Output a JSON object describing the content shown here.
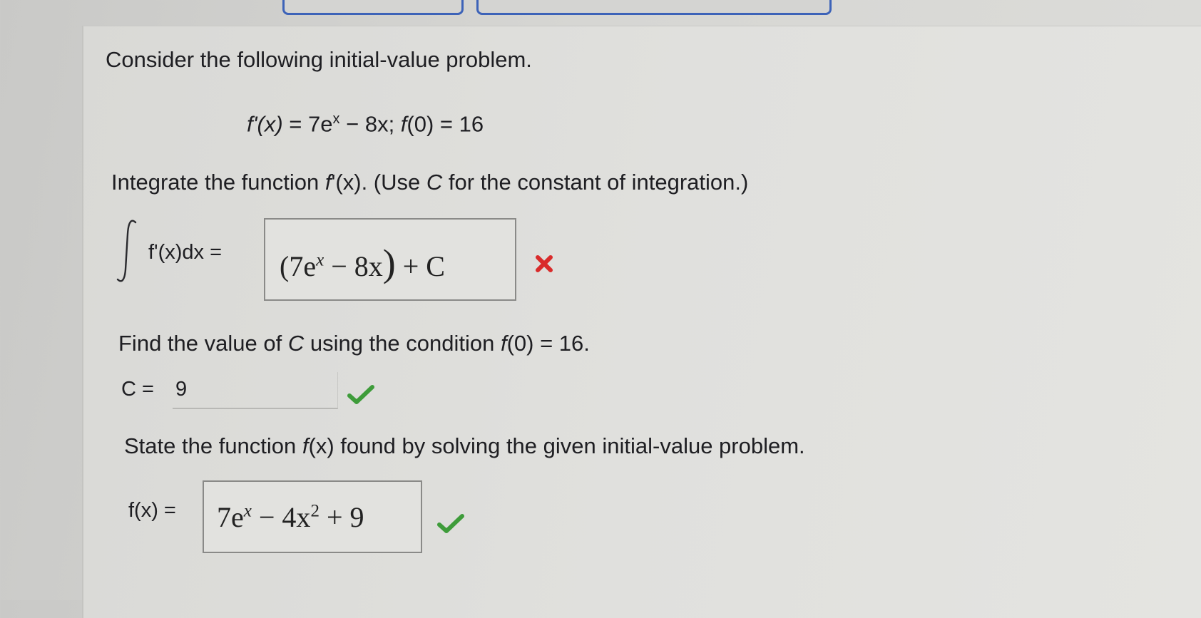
{
  "tabs": [],
  "intro": "Consider the following initial-value problem.",
  "equation": {
    "lhs": "f'(x)",
    "eq1": " = 7e",
    "exp": "x",
    "mid": " − 8x; ",
    "f0": "f",
    "rhs": "(0) = 16"
  },
  "step1": {
    "instruction_a": "Integrate the function ",
    "instruction_f": "f",
    "instruction_b": "'(x). (Use ",
    "instruction_c": "C",
    "instruction_d": " for the constant of integration.)",
    "integral_label": "f'(x)dx =",
    "answer_part1": "(7e",
    "answer_exp": "x",
    "answer_part2": " − 8x",
    "answer_paren": ")",
    "answer_part3": " + C",
    "status": "incorrect",
    "status_color": "#d92b2b"
  },
  "step2": {
    "instruction_a": "Find the value of ",
    "instruction_c": "C",
    "instruction_b": " using the condition ",
    "instruction_f": "f",
    "instruction_d": "(0) = 16.",
    "label": "C =",
    "value": "9",
    "status": "correct",
    "status_color": "#3e9c3a"
  },
  "step3": {
    "instruction_a": "State the function ",
    "instruction_f": "f",
    "instruction_b": "(x) found by solving the given initial-value problem.",
    "label": "f(x) =",
    "answer_part1": "7e",
    "answer_exp": "x",
    "answer_part2": " − 4x",
    "answer_exp2": "2",
    "answer_part3": " + 9",
    "status": "correct",
    "status_color": "#3e9c3a"
  }
}
